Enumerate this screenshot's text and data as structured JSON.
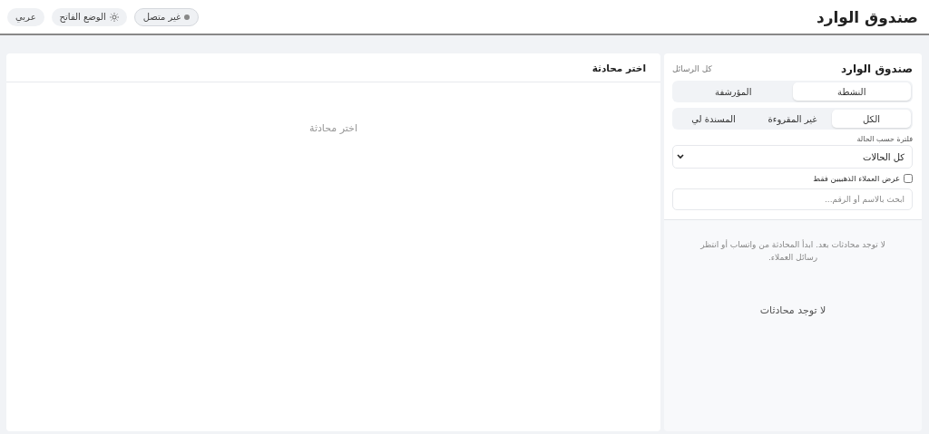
{
  "header": {
    "title": "صندوق الوارد",
    "connection": {
      "label": "غير متصل",
      "connected": false
    },
    "theme": {
      "label": "الوضع الفاتح"
    },
    "language": {
      "label": "عربي"
    }
  },
  "sidebar": {
    "title": "صندوق الوارد",
    "subtitle": "كل الرسائل",
    "archive_tabs": [
      {
        "label": "النشطة",
        "selected": true
      },
      {
        "label": "المؤرشفة",
        "selected": false
      }
    ],
    "filter_tabs": [
      {
        "label": "الكل",
        "selected": true
      },
      {
        "label": "غير المقروءة",
        "selected": false
      },
      {
        "label": "المسندة لي",
        "selected": false
      }
    ],
    "status_filter": {
      "label": "فلترة حسب الحالة",
      "value": "كل الحالات"
    },
    "gold_only": {
      "label": "عرض العملاء الذهبيين فقط",
      "checked": false
    },
    "search": {
      "placeholder": "ابحث بالاسم أو الرقم..."
    },
    "empty_hint": "لا توجد محادثات بعد. ابدأ المحادثة من واتساب أو انتظر رسائل العملاء.",
    "empty_title": "لا توجد محادثات"
  },
  "conversation": {
    "title": "اختر محادثة",
    "placeholder": "اختر محادثة"
  }
}
